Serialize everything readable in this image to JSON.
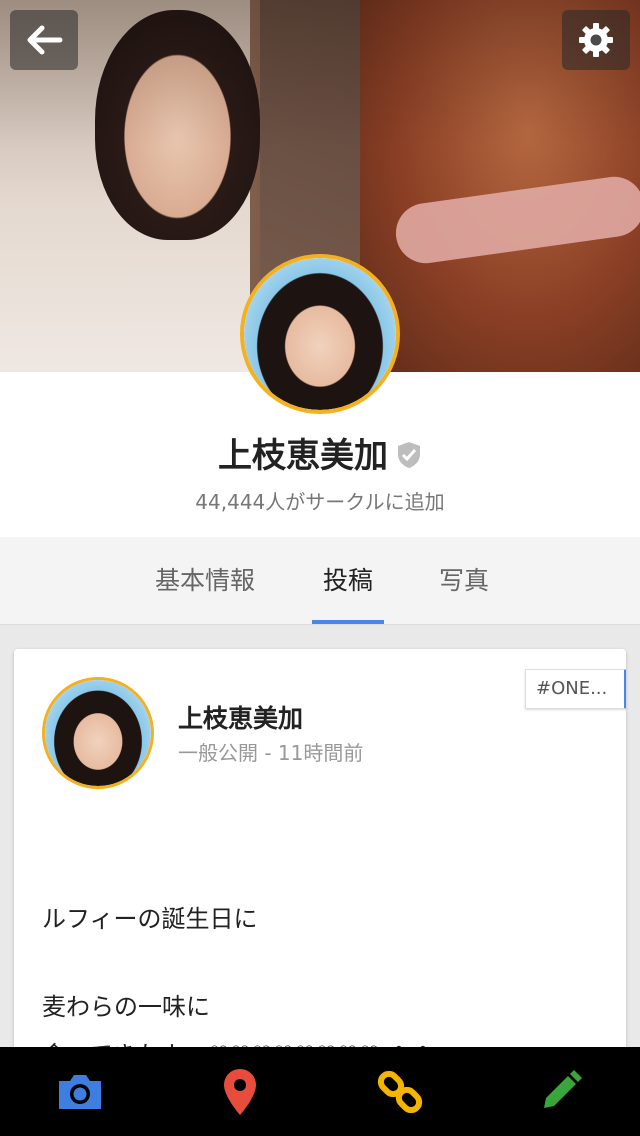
{
  "profile": {
    "name": "上枝恵美加",
    "followers": "44,444人がサークルに追加"
  },
  "tabs": [
    {
      "label": "基本情報",
      "active": false
    },
    {
      "label": "投稿",
      "active": true
    },
    {
      "label": "写真",
      "active": false
    }
  ],
  "post": {
    "author": "上枝恵美加",
    "meta": "一般公開 - 11時間前",
    "tag": "#ONE...",
    "lines": [
      "ルフィーの誕生日に",
      "",
      "麦わらの一味に",
      "会ってきたよー♡♡♡♡♡♡♡♡ぺぺ"
    ]
  },
  "bottom_bar": {
    "items": [
      {
        "icon": "camera-icon",
        "color": "#3d7ee0"
      },
      {
        "icon": "location-pin-icon",
        "color": "#e74c3c"
      },
      {
        "icon": "link-icon",
        "color": "#f4b400"
      },
      {
        "icon": "pencil-icon",
        "color": "#3aa53a"
      }
    ]
  },
  "colors": {
    "accent": "#4a86e8",
    "avatar_ring": "#f5b020"
  }
}
